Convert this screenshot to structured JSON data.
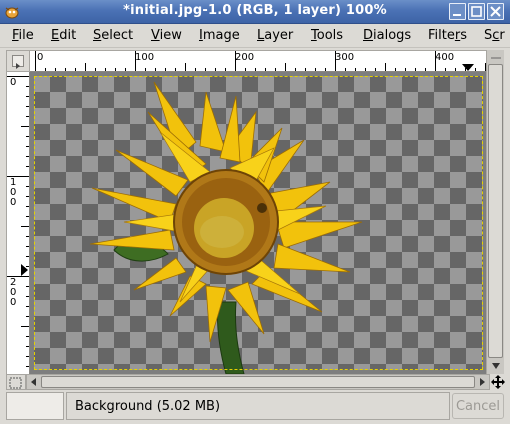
{
  "window": {
    "title": "*initial.jpg-1.0 (RGB, 1 layer) 100%",
    "app_icon": "gimp-wilber-icon",
    "controls": [
      "minimize-icon",
      "maximize-icon",
      "close-icon"
    ]
  },
  "menubar": {
    "items": [
      {
        "label": "File",
        "mnemonic": "F"
      },
      {
        "label": "Edit",
        "mnemonic": "E"
      },
      {
        "label": "Select",
        "mnemonic": "S"
      },
      {
        "label": "View",
        "mnemonic": "V"
      },
      {
        "label": "Image",
        "mnemonic": "I"
      },
      {
        "label": "Layer",
        "mnemonic": "L"
      },
      {
        "label": "Tools",
        "mnemonic": "T"
      },
      {
        "label": "Dialogs",
        "mnemonic": "D"
      },
      {
        "label": "Filters",
        "mnemonic": "r"
      },
      {
        "label": "Scr",
        "mnemonic": "c"
      }
    ]
  },
  "rulers": {
    "horizontal_labels": [
      "0",
      "100",
      "200",
      "300",
      "400"
    ],
    "vertical_labels": [
      "0",
      "100",
      "200"
    ]
  },
  "canvas": {
    "content": "sunflower-image",
    "background": "transparency-checkerboard",
    "boundary_color": "#e6d200"
  },
  "statusbar": {
    "unit": "",
    "message": "Background (5.02 MB)",
    "cancel_label": "Cancel"
  },
  "colors": {
    "titlebar": "#4b72b5",
    "chrome": "#dcdad5"
  }
}
